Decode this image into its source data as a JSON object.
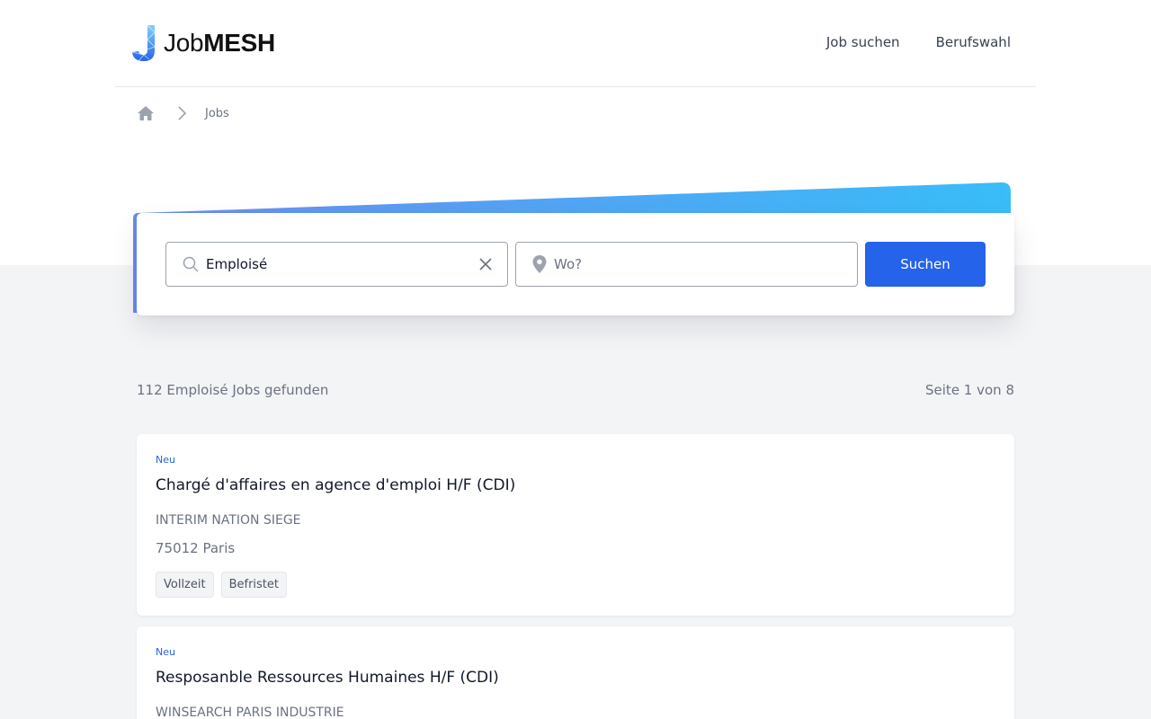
{
  "header": {
    "logo_text_light": "Job",
    "logo_text_bold": "MESH",
    "nav": [
      {
        "label": "Job suchen"
      },
      {
        "label": "Berufswahl"
      }
    ]
  },
  "breadcrumb": {
    "home_icon": "home-icon",
    "separator_icon": "chevron-right-icon",
    "current": "Jobs"
  },
  "search": {
    "what_value": "Emploisé",
    "where_placeholder": "Wo?",
    "button_label": "Suchen"
  },
  "results": {
    "count_text": "112 Emploisé Jobs gefunden",
    "page_text": "Seite 1 von 8"
  },
  "jobs": [
    {
      "badge": "Neu",
      "title": "Chargé d'affaires en agence d'emploi H/F (CDI)",
      "company": "INTERIM NATION SIEGE",
      "location": "75012 Paris",
      "tags": [
        "Vollzeit",
        "Befristet"
      ]
    },
    {
      "badge": "Neu",
      "title": "Resposanble Ressources Humaines H/F (CDI)",
      "company": "WINSEARCH PARIS INDUSTRIE"
    }
  ],
  "colors": {
    "primary": "#2563eb",
    "banner_gradient_start": "#6b8df0",
    "banner_gradient_end": "#38bdf8",
    "page_background": "#f3f4f6"
  }
}
